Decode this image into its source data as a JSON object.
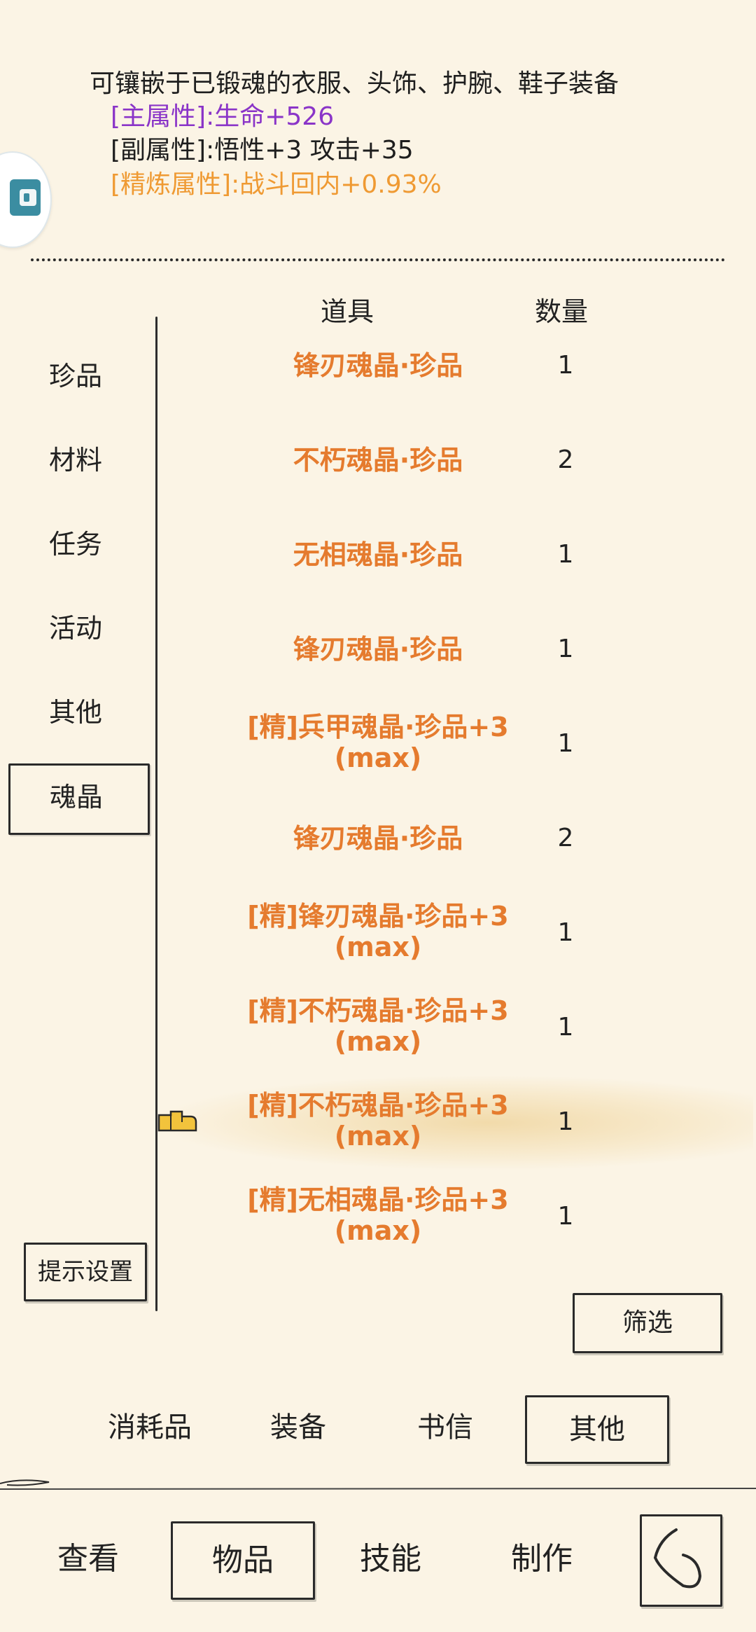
{
  "description": {
    "main": "可镶嵌于已锻魂的衣服、头饰、护腕、鞋子装备",
    "primary": "[主属性]:生命+526",
    "secondary": "[副属性]:悟性+3 攻击+35",
    "refine": "[精炼属性]:战斗回内+0.93%"
  },
  "table": {
    "header_item": "道具",
    "header_qty": "数量",
    "rows": [
      {
        "line1": "锋刃魂晶·珍品",
        "line2": "",
        "qty": "1"
      },
      {
        "line1": "不朽魂晶·珍品",
        "line2": "",
        "qty": "2"
      },
      {
        "line1": "无相魂晶·珍品",
        "line2": "",
        "qty": "1"
      },
      {
        "line1": "锋刃魂晶·珍品",
        "line2": "",
        "qty": "1"
      },
      {
        "line1": "[精]兵甲魂晶·珍品+3",
        "line2": "(max)",
        "qty": "1"
      },
      {
        "line1": "锋刃魂晶·珍品",
        "line2": "",
        "qty": "2"
      },
      {
        "line1": "[精]锋刃魂晶·珍品+3",
        "line2": "(max)",
        "qty": "1"
      },
      {
        "line1": "[精]不朽魂晶·珍品+3",
        "line2": "(max)",
        "qty": "1"
      },
      {
        "line1": "[精]不朽魂晶·珍品+3",
        "line2": "(max)",
        "qty": "1"
      },
      {
        "line1": "[精]无相魂晶·珍品+3",
        "line2": "(max)",
        "qty": "1"
      }
    ]
  },
  "categories": [
    "珍品",
    "材料",
    "任务",
    "活动",
    "其他",
    "魂晶"
  ],
  "selected_category": "魂晶",
  "buttons": {
    "hint_settings": "提示设置",
    "filter": "筛选"
  },
  "sub_tabs": [
    "消耗品",
    "装备",
    "书信",
    "其他"
  ],
  "selected_sub_tab": "其他",
  "bottom_nav": [
    "查看",
    "物品",
    "技能",
    "制作"
  ],
  "selected_nav": "物品",
  "colors": {
    "background": "#fbf4e5",
    "item_name": "#e57b2e",
    "primary_attr": "#8a34c8",
    "refine_attr": "#ef9a33",
    "badge_tile": "#3b8da1"
  },
  "icons": [
    "floating-app-icon",
    "pointing-hand-icon",
    "back-curve-icon"
  ]
}
